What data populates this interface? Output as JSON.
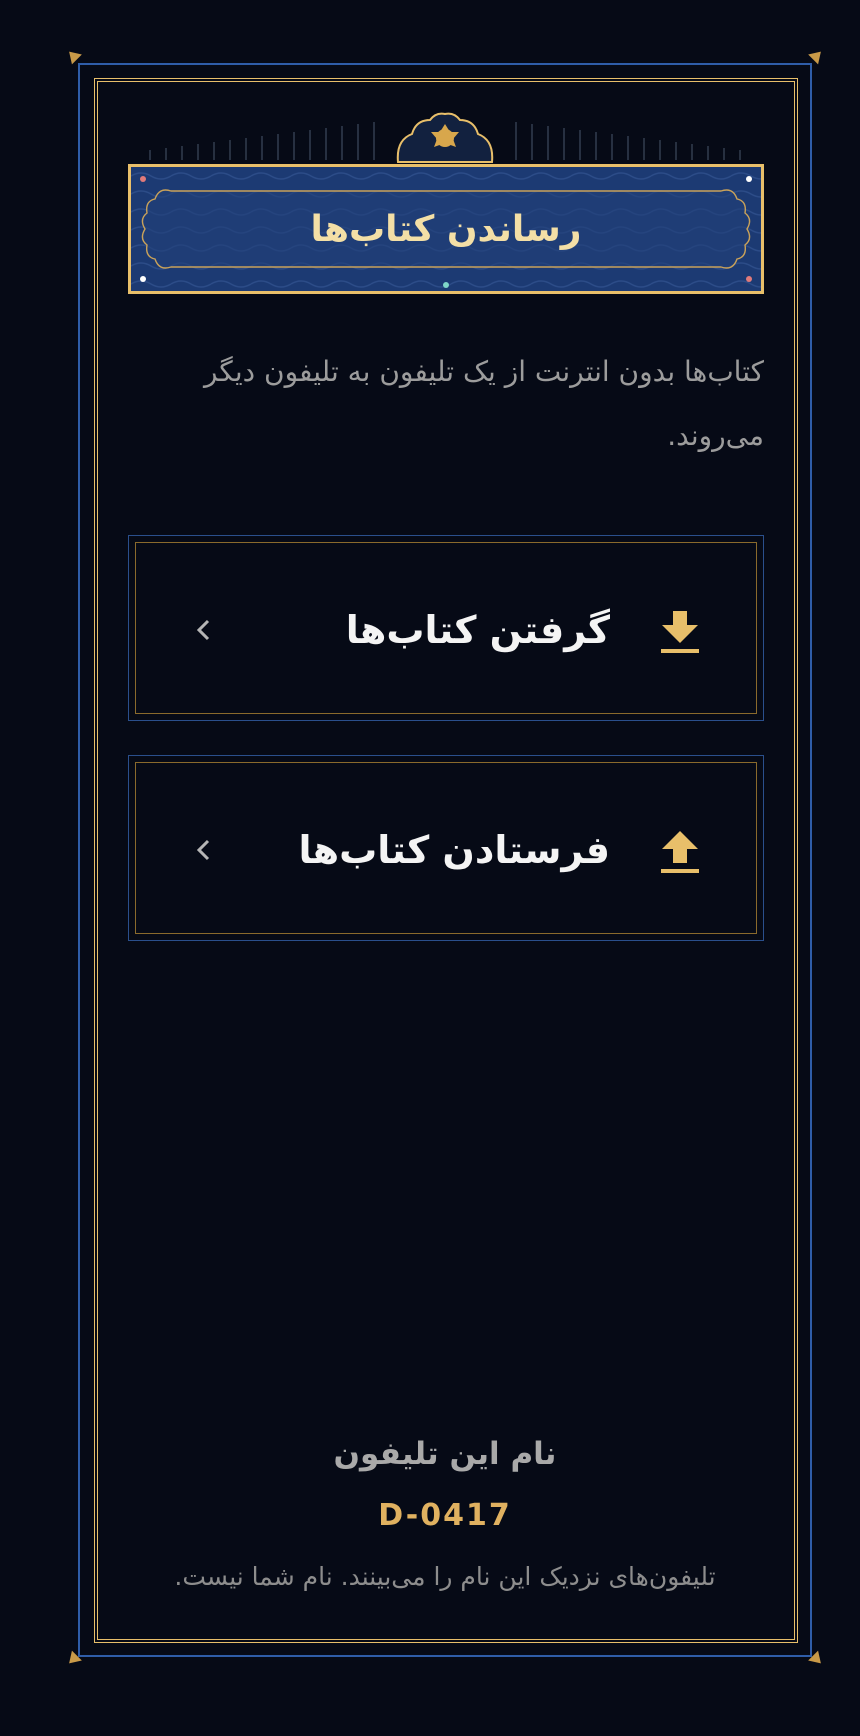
{
  "header": {
    "title": "رساندن کتاب‌ها"
  },
  "description": "کتاب‌ها بدون انترنت از یک تلیفون به تلیفون دیگر می‌روند.",
  "actions": [
    {
      "label": "گرفتن کتاب‌ها",
      "icon": "download-icon"
    },
    {
      "label": "فرستادن کتاب‌ها",
      "icon": "upload-icon"
    }
  ],
  "device": {
    "label": "نام این تلیفون",
    "name": "D-0417",
    "note": "تلیفون‌های نزدیک این نام را می‌بینند. نام شما نیست."
  },
  "colors": {
    "background": "#060a16",
    "gold": "#e8bf6a",
    "blue": "#2f5da8",
    "banner": "#1c3a73"
  }
}
